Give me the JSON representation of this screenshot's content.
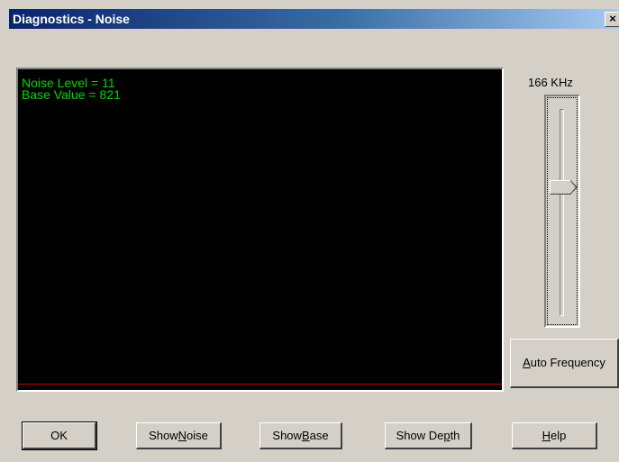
{
  "window": {
    "title": "Diagnostics - Noise",
    "close_glyph": "×"
  },
  "display": {
    "noise_level_text": "Noise Level = 11",
    "base_value_text": "Base Value = 821",
    "text_color": "#00d800",
    "trace_color": "#c00000"
  },
  "frequency": {
    "label": "166 KHz",
    "slider_level_fraction": 0.37
  },
  "buttons": {
    "auto_frequency": {
      "pre": "",
      "mnemonic": "A",
      "post": "uto Frequency"
    },
    "ok": {
      "pre": "OK",
      "mnemonic": "",
      "post": ""
    },
    "show_noise": {
      "pre": "Show ",
      "mnemonic": "N",
      "post": "oise"
    },
    "show_base": {
      "pre": "Show ",
      "mnemonic": "B",
      "post": "ase"
    },
    "show_depth": {
      "pre": "Show De",
      "mnemonic": "p",
      "post": "th"
    },
    "help": {
      "pre": "",
      "mnemonic": "H",
      "post": "elp"
    }
  }
}
